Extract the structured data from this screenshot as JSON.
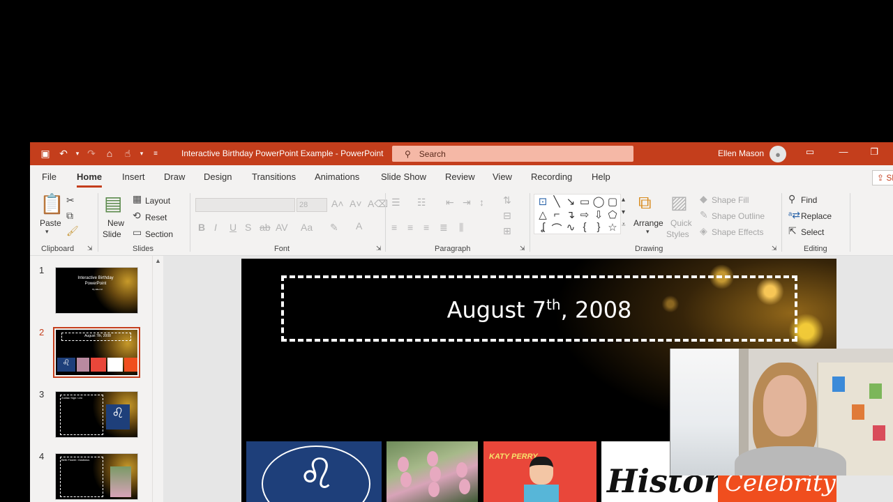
{
  "window": {
    "doc_title": "Interactive Birthday PowerPoint Example  -  PowerPoint",
    "search_placeholder": "Search",
    "user_name": "Ellen Mason"
  },
  "tabs": [
    "File",
    "Home",
    "Insert",
    "Draw",
    "Design",
    "Transitions",
    "Animations",
    "Slide Show",
    "Review",
    "View",
    "Recording",
    "Help"
  ],
  "share_label": "Sh",
  "ribbon": {
    "clipboard": {
      "paste": "Paste",
      "label": "Clipboard"
    },
    "slides": {
      "new_slide_1": "New",
      "new_slide_2": "Slide",
      "layout": "Layout",
      "reset": "Reset",
      "section": "Section",
      "label": "Slides"
    },
    "font": {
      "size": "28",
      "label": "Font"
    },
    "paragraph": {
      "label": "Paragraph"
    },
    "drawing": {
      "arrange": "Arrange",
      "quick_styles_1": "Quick",
      "quick_styles_2": "Styles",
      "shape_fill": "Shape Fill",
      "shape_outline": "Shape Outline",
      "shape_effects": "Shape Effects",
      "label": "Drawing"
    },
    "editing": {
      "find": "Find",
      "replace": "Replace",
      "select": "Select",
      "label": "Editing"
    }
  },
  "thumbnails": [
    {
      "num": "1",
      "text": "Interactive Birthday PowerPoint",
      "sub": "By Ellen M."
    },
    {
      "num": "2",
      "text": "August 7th, 2008"
    },
    {
      "num": "3",
      "text": "Zodiac Sign: Leo"
    },
    {
      "num": "4",
      "text": "Birth Flower: Gladiolus"
    }
  ],
  "slide": {
    "title_main": "August 7",
    "title_sup": "th",
    "title_end": ", 2008",
    "katy_label": "KATY PERRY",
    "history_label": "History",
    "celebrity_label": "Celebrity",
    "leo_glyph": "♌"
  },
  "colors": {
    "accent": "#c43e1c",
    "slide_bg": "#000000"
  }
}
